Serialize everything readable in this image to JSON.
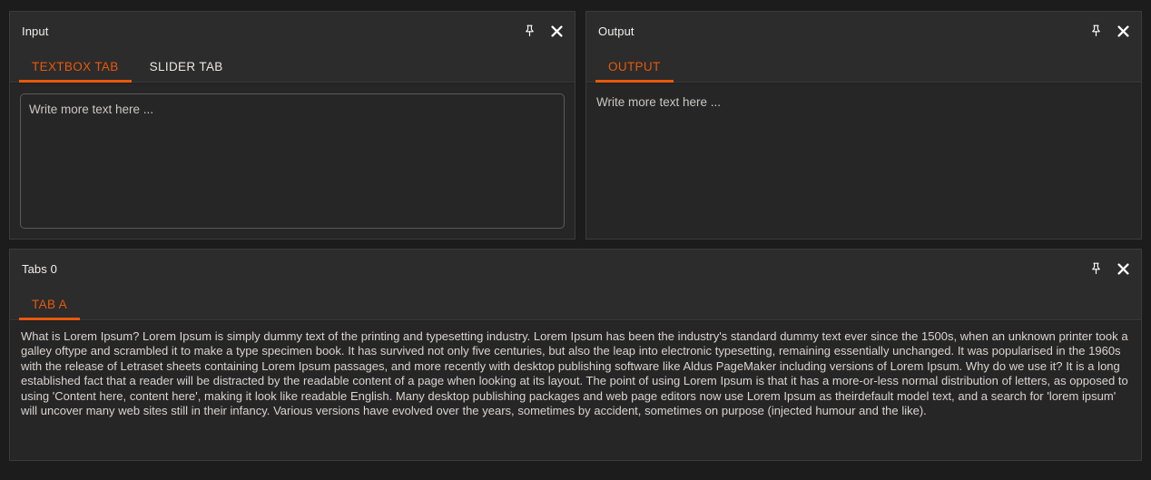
{
  "theme": {
    "accent": "#e8590c",
    "window_bg": "#1c1c1c",
    "panel_bg": "#2c2c2c",
    "body_bg": "#262626",
    "border": "#3b3b3b",
    "text": "#e8e6e3",
    "muted_text": "#c9c7c4"
  },
  "panels": {
    "input": {
      "title": "Input",
      "pin_icon": "pin-icon",
      "close_icon": "close-icon",
      "tabs": [
        {
          "label": "TEXTBOX TAB",
          "active": true
        },
        {
          "label": "SLIDER TAB",
          "active": false
        }
      ],
      "textbox": {
        "value": "",
        "placeholder": "Write more text here ..."
      }
    },
    "output": {
      "title": "Output",
      "pin_icon": "pin-icon",
      "close_icon": "close-icon",
      "tabs": [
        {
          "label": "OUTPUT",
          "active": true
        }
      ],
      "content": "Write more text here ..."
    },
    "tabs_panel": {
      "title": "Tabs 0",
      "pin_icon": "pin-icon",
      "close_icon": "close-icon",
      "tabs": [
        {
          "label": "TAB A",
          "active": true
        }
      ],
      "content": "What is Lorem Ipsum? Lorem Ipsum is simply dummy text of the printing and typesetting industry. Lorem Ipsum has been the industry's standard dummy text ever since the 1500s, when an unknown printer took a galley oftype and scrambled it to make a type specimen book. It has survived not only five centuries, but also the leap into electronic typesetting, remaining essentially unchanged. It was popularised in the 1960s with the release of Letraset sheets containing Lorem Ipsum passages, and more recently with desktop publishing software like Aldus PageMaker including versions of Lorem Ipsum. Why do we use it? It is a long established fact that a reader will be distracted by the readable content of a page when looking at its layout. The point of using Lorem Ipsum is that it has a more-or-less normal distribution of letters, as opposed to using 'Content here, content here', making it look like readable English. Many desktop publishing packages and web page editors now use Lorem Ipsum as theirdefault model text, and a search for 'lorem ipsum' will uncover many web sites still in their infancy. Various versions have evolved over the years, sometimes by accident, sometimes on purpose (injected humour and the like)."
    }
  }
}
